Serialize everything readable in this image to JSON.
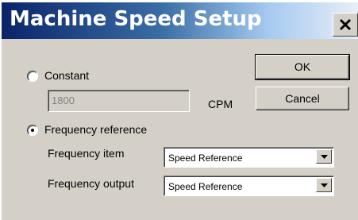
{
  "window": {
    "title": "Machine Speed Setup"
  },
  "options": {
    "constant_label": "Constant",
    "constant_value": "1800",
    "constant_unit": "CPM",
    "frequency_label": "Frequency reference",
    "selected": "frequency_reference"
  },
  "frequency": {
    "item_label": "Frequency item",
    "item_value": "Speed Reference",
    "output_label": "Frequency output",
    "output_value": "Speed Reference"
  },
  "buttons": {
    "ok": "OK",
    "cancel": "Cancel"
  },
  "icons": {
    "close": "close-icon",
    "dropdown": "chevron-down-icon"
  },
  "colors": {
    "title_bar_start": "#0a246a",
    "title_bar_end": "#e8eef7",
    "face": "#d4d0c8"
  }
}
